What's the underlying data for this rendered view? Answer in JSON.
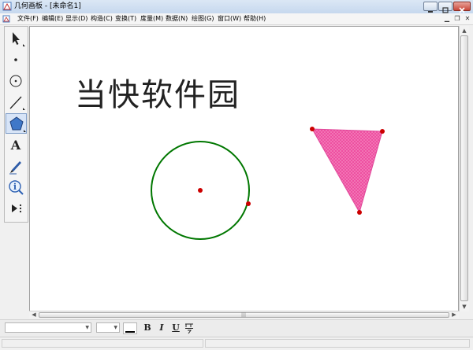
{
  "window": {
    "title": "几何画板 - [未命名1]"
  },
  "menubar": {
    "items": [
      "文件(F)",
      "编辑(E)",
      "显示(D)",
      "构造(C)",
      "变换(T)",
      "度量(M)",
      "数据(N)",
      "绘图(G)",
      "窗口(W)",
      "帮助(H)"
    ]
  },
  "toolbox": {
    "tools": [
      {
        "name": "selection-arrow-tool"
      },
      {
        "name": "point-tool"
      },
      {
        "name": "compass-tool"
      },
      {
        "name": "straightedge-tool"
      },
      {
        "name": "polygon-tool",
        "selected": true
      },
      {
        "name": "text-tool",
        "glyph": "A"
      },
      {
        "name": "marker-tool"
      },
      {
        "name": "information-tool",
        "glyph": "i"
      },
      {
        "name": "custom-tool"
      }
    ]
  },
  "canvas": {
    "text": "当快软件园",
    "circle": {
      "stroke": "#007700",
      "center_color": "#cc0000"
    },
    "triangle": {
      "fill": "#ee4fa1",
      "vertex_color": "#cc0000"
    }
  },
  "formatbar": {
    "bold_label": "B",
    "italic_label": "I",
    "underline_label": "U"
  }
}
